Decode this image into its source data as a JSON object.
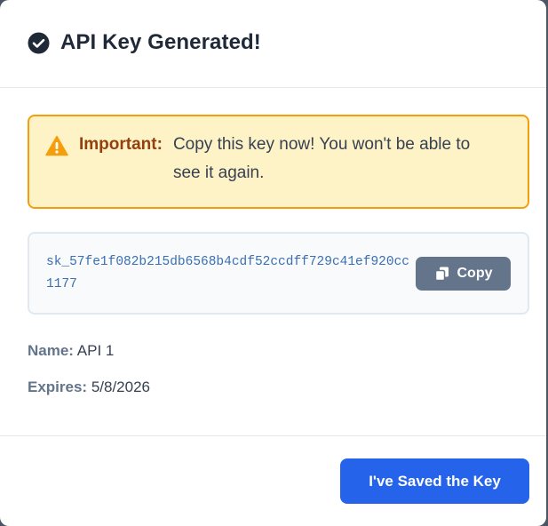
{
  "modal": {
    "title": "API Key Generated!",
    "header_icon": "check-circle-icon",
    "warning": {
      "icon": "warning-triangle-icon",
      "label": "Important:",
      "text": "Copy this key now! You won't be able to see it again."
    },
    "key": {
      "value": "sk_57fe1f082b215db6568b4cdf52ccdff729c41ef920cc1177",
      "copy_label": "Copy",
      "copy_icon": "copy-icon"
    },
    "details": {
      "name_label": "Name:",
      "name_value": "API 1",
      "expires_label": "Expires:",
      "expires_value": "5/8/2026"
    },
    "footer": {
      "confirm_label": "I've Saved the Key"
    }
  },
  "colors": {
    "title": "#1f2937",
    "warning_bg": "#fef3c7",
    "warning_border": "#f59e0b",
    "warning_label": "#92400e",
    "key_text": "#3b6fb0",
    "copy_button": "#64748b",
    "primary_button": "#2563eb"
  }
}
